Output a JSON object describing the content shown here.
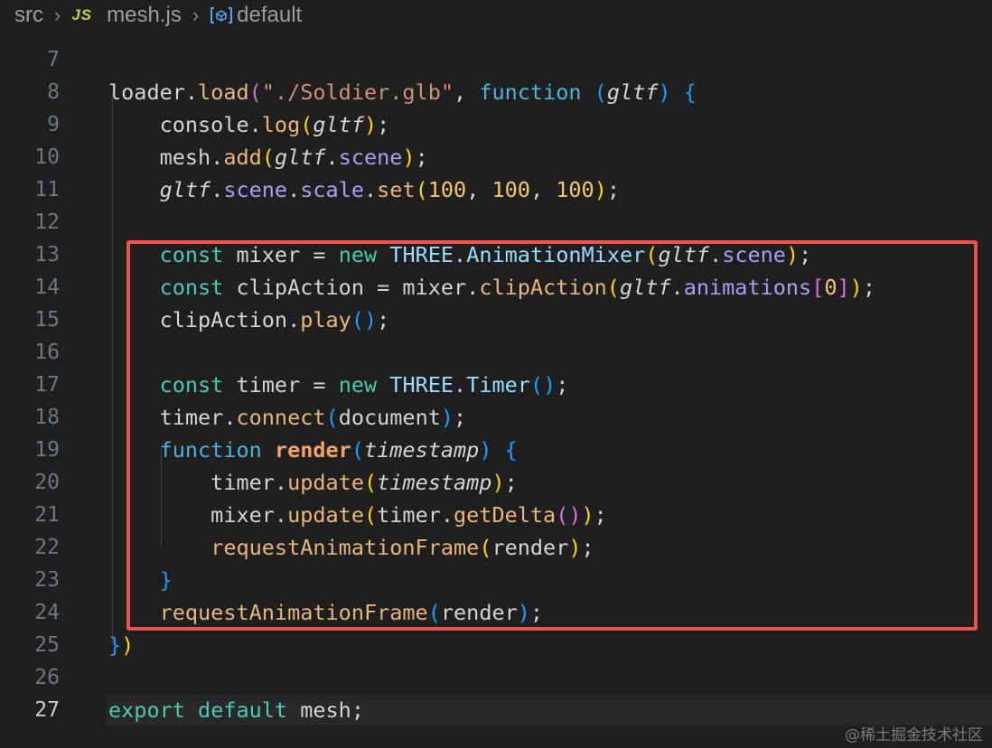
{
  "breadcrumb": {
    "folder": "src",
    "file_icon": "JS",
    "file": "mesh.js",
    "symbol_icon": "symbol-namespace-icon",
    "symbol": "default"
  },
  "editor": {
    "current_line": 27,
    "lines": [
      {
        "n": "7",
        "tokens": []
      },
      {
        "n": "8",
        "tokens": [
          [
            "plain",
            "loader."
          ],
          [
            "fn",
            "load"
          ],
          [
            "p2",
            "("
          ],
          [
            "str",
            "\"./Soldier.glb\""
          ],
          [
            "plain",
            ", "
          ],
          [
            "kwfn",
            "function"
          ],
          [
            "plain",
            " "
          ],
          [
            "p3",
            "("
          ],
          [
            "param",
            "gltf"
          ],
          [
            "p3",
            ")"
          ],
          [
            "plain",
            " "
          ],
          [
            "p3",
            "{"
          ]
        ]
      },
      {
        "n": "9",
        "tokens": [
          [
            "plain",
            "    console."
          ],
          [
            "fn",
            "log"
          ],
          [
            "p1",
            "("
          ],
          [
            "param",
            "gltf"
          ],
          [
            "p1",
            ")"
          ],
          [
            "plain",
            ";"
          ]
        ]
      },
      {
        "n": "10",
        "tokens": [
          [
            "plain",
            "    mesh."
          ],
          [
            "fn",
            "add"
          ],
          [
            "p1",
            "("
          ],
          [
            "param",
            "gltf"
          ],
          [
            "plain",
            "."
          ],
          [
            "prop",
            "scene"
          ],
          [
            "p1",
            ")"
          ],
          [
            "plain",
            ";"
          ]
        ]
      },
      {
        "n": "11",
        "tokens": [
          [
            "plain",
            "    "
          ],
          [
            "param",
            "gltf"
          ],
          [
            "plain",
            "."
          ],
          [
            "prop",
            "scene"
          ],
          [
            "plain",
            "."
          ],
          [
            "prop",
            "scale"
          ],
          [
            "plain",
            "."
          ],
          [
            "fn",
            "set"
          ],
          [
            "p1",
            "("
          ],
          [
            "num",
            "100"
          ],
          [
            "plain",
            ", "
          ],
          [
            "num",
            "100"
          ],
          [
            "plain",
            ", "
          ],
          [
            "num",
            "100"
          ],
          [
            "p1",
            ")"
          ],
          [
            "plain",
            ";"
          ]
        ]
      },
      {
        "n": "12",
        "tokens": []
      },
      {
        "n": "13",
        "tokens": [
          [
            "plain",
            "    "
          ],
          [
            "kw",
            "const"
          ],
          [
            "plain",
            " mixer = "
          ],
          [
            "kw",
            "new"
          ],
          [
            "plain",
            " "
          ],
          [
            "cls",
            "THREE"
          ],
          [
            "plain",
            "."
          ],
          [
            "cls",
            "AnimationMixer"
          ],
          [
            "p1",
            "("
          ],
          [
            "param",
            "gltf"
          ],
          [
            "plain",
            "."
          ],
          [
            "prop",
            "scene"
          ],
          [
            "p1",
            ")"
          ],
          [
            "plain",
            ";"
          ]
        ]
      },
      {
        "n": "14",
        "tokens": [
          [
            "plain",
            "    "
          ],
          [
            "kw",
            "const"
          ],
          [
            "plain",
            " clipAction = mixer."
          ],
          [
            "fn",
            "clipAction"
          ],
          [
            "p1",
            "("
          ],
          [
            "param",
            "gltf"
          ],
          [
            "plain",
            "."
          ],
          [
            "prop",
            "animations"
          ],
          [
            "p2",
            "["
          ],
          [
            "num",
            "0"
          ],
          [
            "p2",
            "]"
          ],
          [
            "p1",
            ")"
          ],
          [
            "plain",
            ";"
          ]
        ]
      },
      {
        "n": "15",
        "tokens": [
          [
            "plain",
            "    clipAction."
          ],
          [
            "fn",
            "play"
          ],
          [
            "p3",
            "()"
          ],
          [
            "plain",
            ";"
          ]
        ]
      },
      {
        "n": "16",
        "tokens": []
      },
      {
        "n": "17",
        "tokens": [
          [
            "plain",
            "    "
          ],
          [
            "kw",
            "const"
          ],
          [
            "plain",
            " timer = "
          ],
          [
            "kw",
            "new"
          ],
          [
            "plain",
            " "
          ],
          [
            "cls",
            "THREE"
          ],
          [
            "plain",
            "."
          ],
          [
            "cls",
            "Timer"
          ],
          [
            "p3",
            "()"
          ],
          [
            "plain",
            ";"
          ]
        ]
      },
      {
        "n": "18",
        "tokens": [
          [
            "plain",
            "    timer."
          ],
          [
            "fn",
            "connect"
          ],
          [
            "p3",
            "("
          ],
          [
            "plain",
            "document"
          ],
          [
            "p3",
            ")"
          ],
          [
            "plain",
            ";"
          ]
        ]
      },
      {
        "n": "19",
        "tokens": [
          [
            "plain",
            "    "
          ],
          [
            "kwfn",
            "function"
          ],
          [
            "plain",
            " "
          ],
          [
            "fnbold",
            "render"
          ],
          [
            "p3",
            "("
          ],
          [
            "param",
            "timestamp"
          ],
          [
            "p3",
            ")"
          ],
          [
            "plain",
            " "
          ],
          [
            "p3",
            "{"
          ]
        ]
      },
      {
        "n": "20",
        "tokens": [
          [
            "plain",
            "        timer."
          ],
          [
            "fn",
            "update"
          ],
          [
            "p1",
            "("
          ],
          [
            "param",
            "timestamp"
          ],
          [
            "p1",
            ")"
          ],
          [
            "plain",
            ";"
          ]
        ]
      },
      {
        "n": "21",
        "tokens": [
          [
            "plain",
            "        mixer."
          ],
          [
            "fn",
            "update"
          ],
          [
            "p1",
            "("
          ],
          [
            "plain",
            "timer."
          ],
          [
            "fn",
            "getDelta"
          ],
          [
            "p2",
            "()"
          ],
          [
            "p1",
            ")"
          ],
          [
            "plain",
            ";"
          ]
        ]
      },
      {
        "n": "22",
        "tokens": [
          [
            "plain",
            "        "
          ],
          [
            "fn",
            "requestAnimationFrame"
          ],
          [
            "p1",
            "("
          ],
          [
            "plain",
            "render"
          ],
          [
            "p1",
            ")"
          ],
          [
            "plain",
            ";"
          ]
        ]
      },
      {
        "n": "23",
        "tokens": [
          [
            "plain",
            "    "
          ],
          [
            "p3",
            "}"
          ]
        ]
      },
      {
        "n": "24",
        "tokens": [
          [
            "plain",
            "    "
          ],
          [
            "fn",
            "requestAnimationFrame"
          ],
          [
            "p3",
            "("
          ],
          [
            "plain",
            "render"
          ],
          [
            "p3",
            ")"
          ],
          [
            "plain",
            ";"
          ]
        ]
      },
      {
        "n": "25",
        "tokens": [
          [
            "p3",
            "}"
          ],
          [
            "p1",
            ")"
          ]
        ]
      },
      {
        "n": "26",
        "tokens": []
      },
      {
        "n": "27",
        "tokens": [
          [
            "kw",
            "export"
          ],
          [
            "plain",
            " "
          ],
          [
            "kw",
            "default"
          ],
          [
            "plain",
            " mesh;"
          ]
        ]
      }
    ]
  },
  "colors": {
    "background": "#1f1f1f",
    "highlight_border": "#ef5350"
  },
  "watermark": "@稀土掘金技术社区"
}
